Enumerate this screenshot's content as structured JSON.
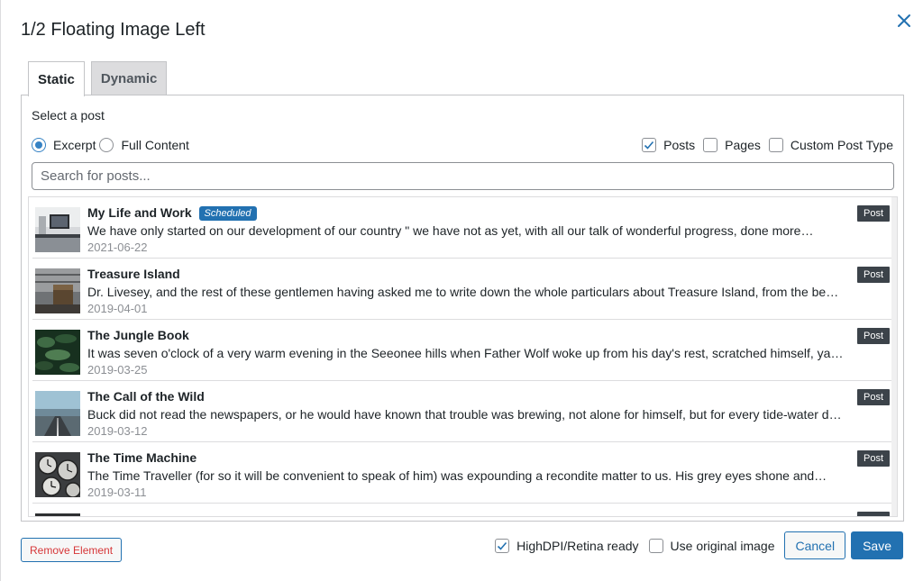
{
  "dialog": {
    "title": "1/2 Floating Image Left",
    "close_icon": "close-icon"
  },
  "tabs": [
    {
      "label": "Static",
      "active": true
    },
    {
      "label": "Dynamic",
      "active": false
    }
  ],
  "panel": {
    "select_label": "Select a post",
    "content_mode": {
      "options": [
        "Excerpt",
        "Full Content"
      ],
      "selected": "Excerpt"
    },
    "post_types": [
      {
        "label": "Posts",
        "checked": true
      },
      {
        "label": "Pages",
        "checked": false
      },
      {
        "label": "Custom Post Type",
        "checked": false
      }
    ],
    "search": {
      "placeholder": "Search for posts...",
      "value": ""
    },
    "posts": [
      {
        "title": "My Life and Work",
        "status_badge": "Scheduled",
        "excerpt": "We have only started on our development of our country \" we have not as yet, with all our talk of wonderful progress, done more…",
        "date": "2021-06-22",
        "type": "Post",
        "thumb": "desk"
      },
      {
        "title": "Treasure Island",
        "status_badge": "",
        "excerpt": "Dr. Livesey, and the rest of these gentlemen having asked me to write down the whole particulars about Treasure Island, from the be…",
        "date": "2019-04-01",
        "type": "Post",
        "thumb": "chest"
      },
      {
        "title": "The Jungle Book",
        "status_badge": "",
        "excerpt": "It was seven o'clock of a very warm evening in the Seeonee hills when Father Wolf woke up from his day's rest, scratched himself, ya…",
        "date": "2019-03-25",
        "type": "Post",
        "thumb": "jungle"
      },
      {
        "title": "The Call of the Wild",
        "status_badge": "",
        "excerpt": "Buck did not read the newspapers, or he would have known that trouble was brewing, not alone for himself, but for every tide-water d…",
        "date": "2019-03-12",
        "type": "Post",
        "thumb": "road"
      },
      {
        "title": "The Time Machine",
        "status_badge": "",
        "excerpt": "The Time Traveller (for so it will be convenient to speak of him) was expounding a recondite matter to us. His grey eyes shone and…",
        "date": "2019-03-11",
        "type": "Post",
        "thumb": "clocks"
      }
    ]
  },
  "footer": {
    "remove_label": "Remove Element",
    "hidpi": {
      "label": "HighDPI/Retina ready",
      "checked": true
    },
    "original_image": {
      "label": "Use original image",
      "checked": false
    },
    "cancel_label": "Cancel",
    "save_label": "Save"
  },
  "colors": {
    "accent": "#2271b1",
    "danger": "#d63638",
    "badge_dark": "#3c434a"
  }
}
